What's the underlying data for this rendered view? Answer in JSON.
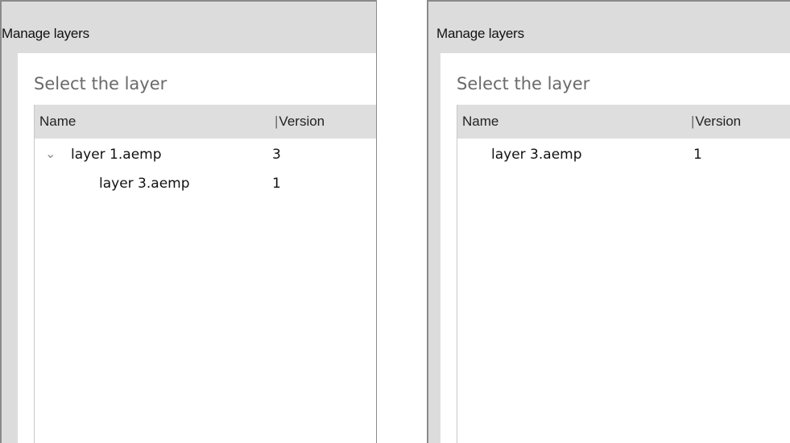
{
  "left": {
    "title": "Manage layers",
    "section_label": "Select the layer",
    "columns": {
      "name": "Name",
      "separator": "|",
      "version": "Version"
    },
    "rows": [
      {
        "expand_icon": "chevron-down-icon",
        "name": "layer 1.aemp",
        "version": "3"
      },
      {
        "name": "layer 3.aemp",
        "version": "1"
      }
    ]
  },
  "right": {
    "title": "Manage layers",
    "section_label": "Select the layer",
    "columns": {
      "name": "Name",
      "separator": "|",
      "version": "Version"
    },
    "rows": [
      {
        "name": "layer 3.aemp",
        "version": "1"
      }
    ]
  }
}
